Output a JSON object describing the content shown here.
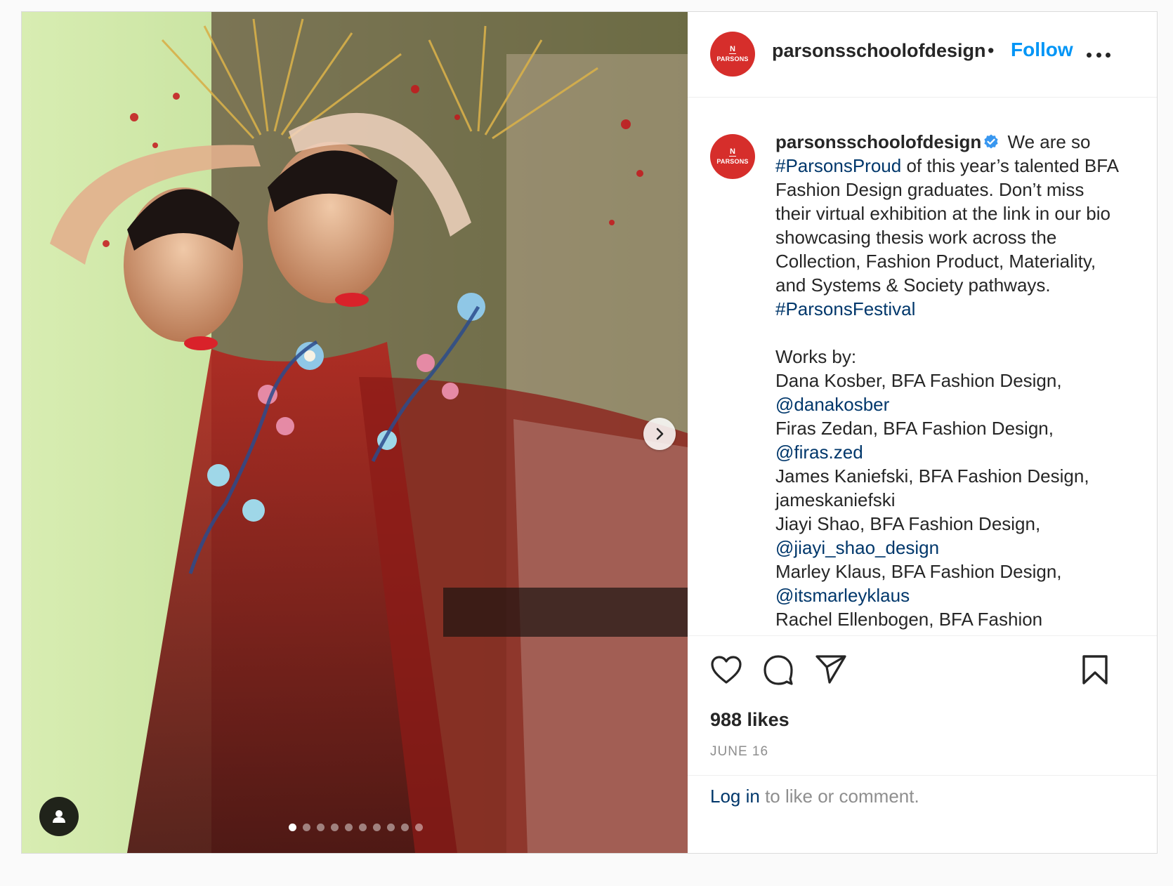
{
  "post": {
    "username": "parsonsschoolofdesign",
    "header_separator": "•",
    "follow_label": "Follow",
    "avatar_mark": "N",
    "avatar_wordmark": "PARSONS",
    "caption": {
      "intro_1": "We are so",
      "hashtag_1": "#ParsonsProud",
      "intro_2": "of this year’s talented BFA Fashion Design graduates. Don’t miss their virtual exhibition at the link in our bio showcasing thesis work across the Collection, Fashion Product, Materiality, and Systems & Society pathways.",
      "hashtag_2": "#ParsonsFestival",
      "works_by_label": "Works by:",
      "credits": [
        {
          "text": "Dana Kosber, BFA Fashion Design,",
          "handle": "@danakosber",
          "handle_is_link": true
        },
        {
          "text": "Firas Zedan, BFA Fashion Design,",
          "handle": "@firas.zed",
          "handle_is_link": true
        },
        {
          "text": "James Kaniefski, BFA Fashion Design,",
          "handle": "jameskaniefski",
          "handle_is_link": false
        },
        {
          "text": "Jiayi Shao, BFA Fashion Design,",
          "handle": "@jiayi_shao_design",
          "handle_is_link": true
        },
        {
          "text": "Marley Klaus, BFA Fashion Design,",
          "handle": "@itsmarleyklaus",
          "handle_is_link": true
        }
      ],
      "truncated_line": "Rachel Ellenbogen, BFA Fashion"
    },
    "likes": "988 likes",
    "date": "JUNE 16",
    "login_link": "Log in",
    "login_suffix": " to like or comment."
  },
  "carousel": {
    "total_slides": 10,
    "active_slide": 1
  },
  "icons": {
    "like": "heart-icon",
    "comment": "comment-bubble-icon",
    "share": "paper-plane-icon",
    "save": "bookmark-icon",
    "next": "chevron-right-icon",
    "tags": "user-tag-icon",
    "verified": "verified-badge-icon",
    "more": "more-options-icon"
  },
  "colors": {
    "follow": "#0095f6",
    "link": "#00376b",
    "muted": "#8e8e8e",
    "brand_red": "#d62e2b"
  }
}
